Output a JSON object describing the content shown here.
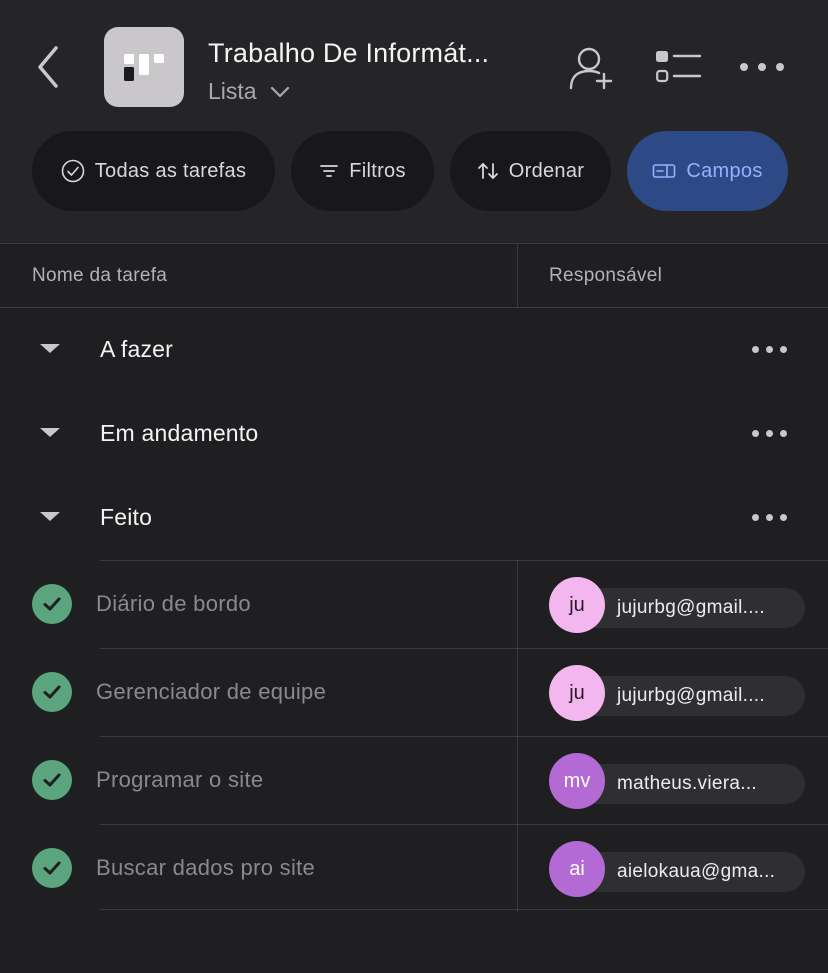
{
  "header": {
    "project_title": "Trabalho De Informát...",
    "view_name": "Lista"
  },
  "toolbar": {
    "all_tasks": "Todas as tarefas",
    "filters": "Filtros",
    "sort": "Ordenar",
    "fields": "Campos"
  },
  "columns": {
    "task_name": "Nome da tarefa",
    "assignee": "Responsável"
  },
  "sections": [
    {
      "name": "A fazer"
    },
    {
      "name": "Em andamento"
    },
    {
      "name": "Feito"
    }
  ],
  "tasks": [
    {
      "name": "Diário de bordo",
      "completed": true,
      "assignee": {
        "initials": "ju",
        "email": "jujurbg@gmail....",
        "avatar_color": "#f4b6ee",
        "text_color": "#2b1a2a"
      }
    },
    {
      "name": "Gerenciador de equipe",
      "completed": true,
      "assignee": {
        "initials": "ju",
        "email": "jujurbg@gmail....",
        "avatar_color": "#f4b6ee",
        "text_color": "#2b1a2a"
      }
    },
    {
      "name": "Programar o site",
      "completed": true,
      "assignee": {
        "initials": "mv",
        "email": "matheus.viera...",
        "avatar_color": "#b46ad4",
        "text_color": "#ffffff"
      }
    },
    {
      "name": "Buscar dados pro site",
      "completed": true,
      "assignee": {
        "initials": "ai",
        "email": "aielokaua@gma...",
        "avatar_color": "#b46ad4",
        "text_color": "#ffffff"
      }
    }
  ],
  "colors": {
    "background": "#1f1f21",
    "header_bg": "#252528",
    "accent_pill": "#2e4a86",
    "accent_text": "#8fb3ff",
    "check_green": "#5aa57d"
  }
}
